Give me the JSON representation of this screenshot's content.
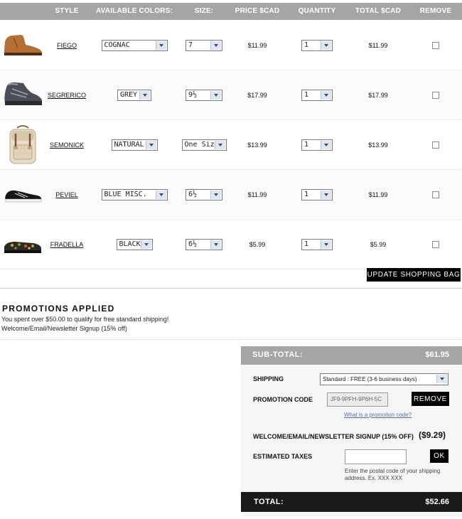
{
  "headers": {
    "style": "STYLE",
    "colors": "AVAILABLE COLORS:",
    "size": "SIZE:",
    "price": "PRICE $CAD",
    "quantity": "QUANTITY",
    "total": "TOTAL $CAD",
    "remove": "REMOVE"
  },
  "items": [
    {
      "name": "FIEGO",
      "color": "COGNAC",
      "size": "7",
      "price": "$11.99",
      "qty": "1",
      "total": "$11.99"
    },
    {
      "name": "SEGRERICO",
      "color": "GREY",
      "size": "9½",
      "price": "$17.99",
      "qty": "1",
      "total": "$17.99"
    },
    {
      "name": "SEMONICK",
      "color": "NATURAL",
      "size": "One Size",
      "price": "$13.99",
      "qty": "1",
      "total": "$13.99"
    },
    {
      "name": "PEVIEL",
      "color": "BLUE MISC.",
      "size": "6½",
      "price": "$11.99",
      "qty": "1",
      "total": "$11.99"
    },
    {
      "name": "FRADELLA",
      "color": "BLACK",
      "size": "6½",
      "price": "$5.99",
      "qty": "1",
      "total": "$5.99"
    }
  ],
  "update_button": "UPDATE SHOPPING BAG",
  "promotions": {
    "title": "PROMOTIONS APPLIED",
    "lines": [
      "You spent over $50.00 to qualify for free standard shipping!",
      "Welcome/Email/Newsletter Signup (15% off)"
    ]
  },
  "summary": {
    "subtotal_label": "SUB-TOTAL:",
    "subtotal_value": "$61.95",
    "shipping_label": "SHIPPING",
    "shipping_value": "Standard : FREE (3-6 business days)",
    "promo_label": "PROMOTION CODE",
    "promo_code": "JF9-9PFH-9P6H-5C",
    "remove_button": "REMOVE",
    "promo_link": "What is a promotion code?",
    "discount_label": "WELCOME/EMAIL/NEWSLETTER SIGNUP (15% OFF)",
    "discount_value": "($9.29)",
    "taxes_label": "ESTIMATED TAXES",
    "ok_button": "OK",
    "taxes_note": "Enter the postal code of your shipping address. Ex. XXX XXX",
    "total_label": "TOTAL:",
    "total_value": "$52.66"
  }
}
